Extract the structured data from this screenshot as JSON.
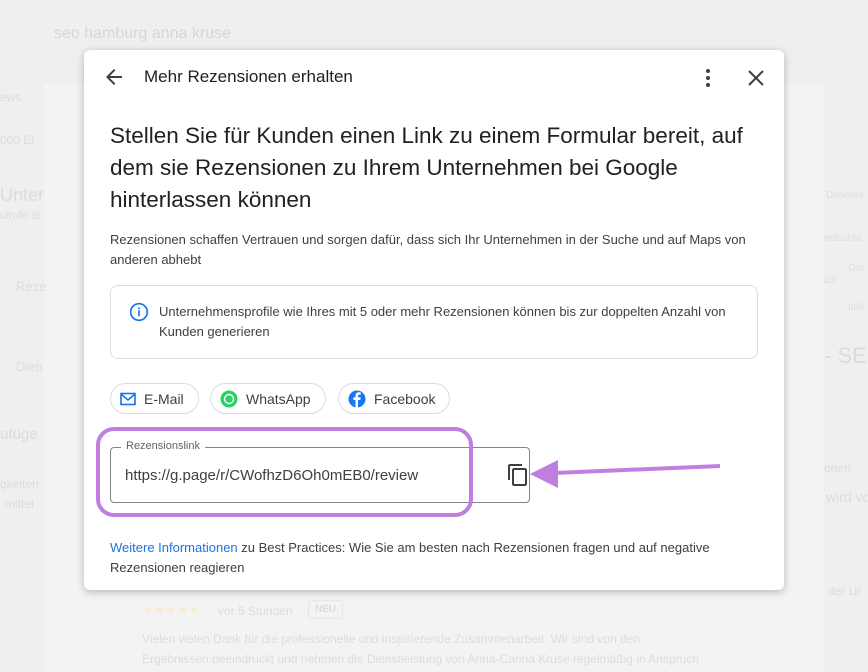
{
  "background": {
    "search_query": "seo hamburg anna kruse",
    "left_texts": [
      "ews",
      "000 Er",
      "Unter",
      "ufrufe di",
      "Reze",
      "Dien",
      "ufüge",
      "gkeiten",
      "mittel"
    ],
    "right_texts": [
      "Dänema",
      "eutschla",
      "Öst",
      "ich",
      "Itali",
      "- SE",
      "onen",
      "wird vo",
      "der Ur"
    ],
    "review": {
      "stars": "★★★★★",
      "time": "vor 5 Stunden",
      "badge": "NEU",
      "text_line1": "Vielen vielen Dank für die professionelle und inspirierende Zusammenarbeit. Wir sind von den",
      "text_line2": "Ergebnissen beeindruckt und nehmen die Dienstleistung von Anna-Carina Kruse regelmäßig in Anspruch"
    }
  },
  "dialog": {
    "title": "Mehr Rezensionen erhalten",
    "headline": "Stellen Sie für Kunden einen Link zu einem Formular bereit, auf dem sie Rezensionen zu Ihrem Unternehmen bei Google hinterlassen können",
    "subtitle": "Rezensionen schaffen Vertrauen und sorgen dafür, dass sich Ihr Unternehmen in der Suche und auf Maps von anderen abhebt",
    "info": "Unternehmensprofile wie Ihres mit 5 oder mehr Rezensionen können bis zur doppelten Anzahl von Kunden generieren",
    "share": [
      {
        "label": "E-Mail",
        "icon": "mail-icon"
      },
      {
        "label": "WhatsApp",
        "icon": "whatsapp-icon"
      },
      {
        "label": "Facebook",
        "icon": "facebook-icon"
      }
    ],
    "link_label": "Rezensionslink",
    "link_value": "https://g.page/r/CWofhzD6Oh0mEB0/review",
    "footer_link": "Weitere Informationen",
    "footer_text": " zu Best Practices: Wie Sie am besten nach Rezensionen fragen und auf negative Rezensionen reagieren"
  },
  "colors": {
    "accent": "#1a73e8",
    "highlight": "#c07ee0",
    "whatsapp": "#25d366",
    "facebook": "#1877f2"
  }
}
